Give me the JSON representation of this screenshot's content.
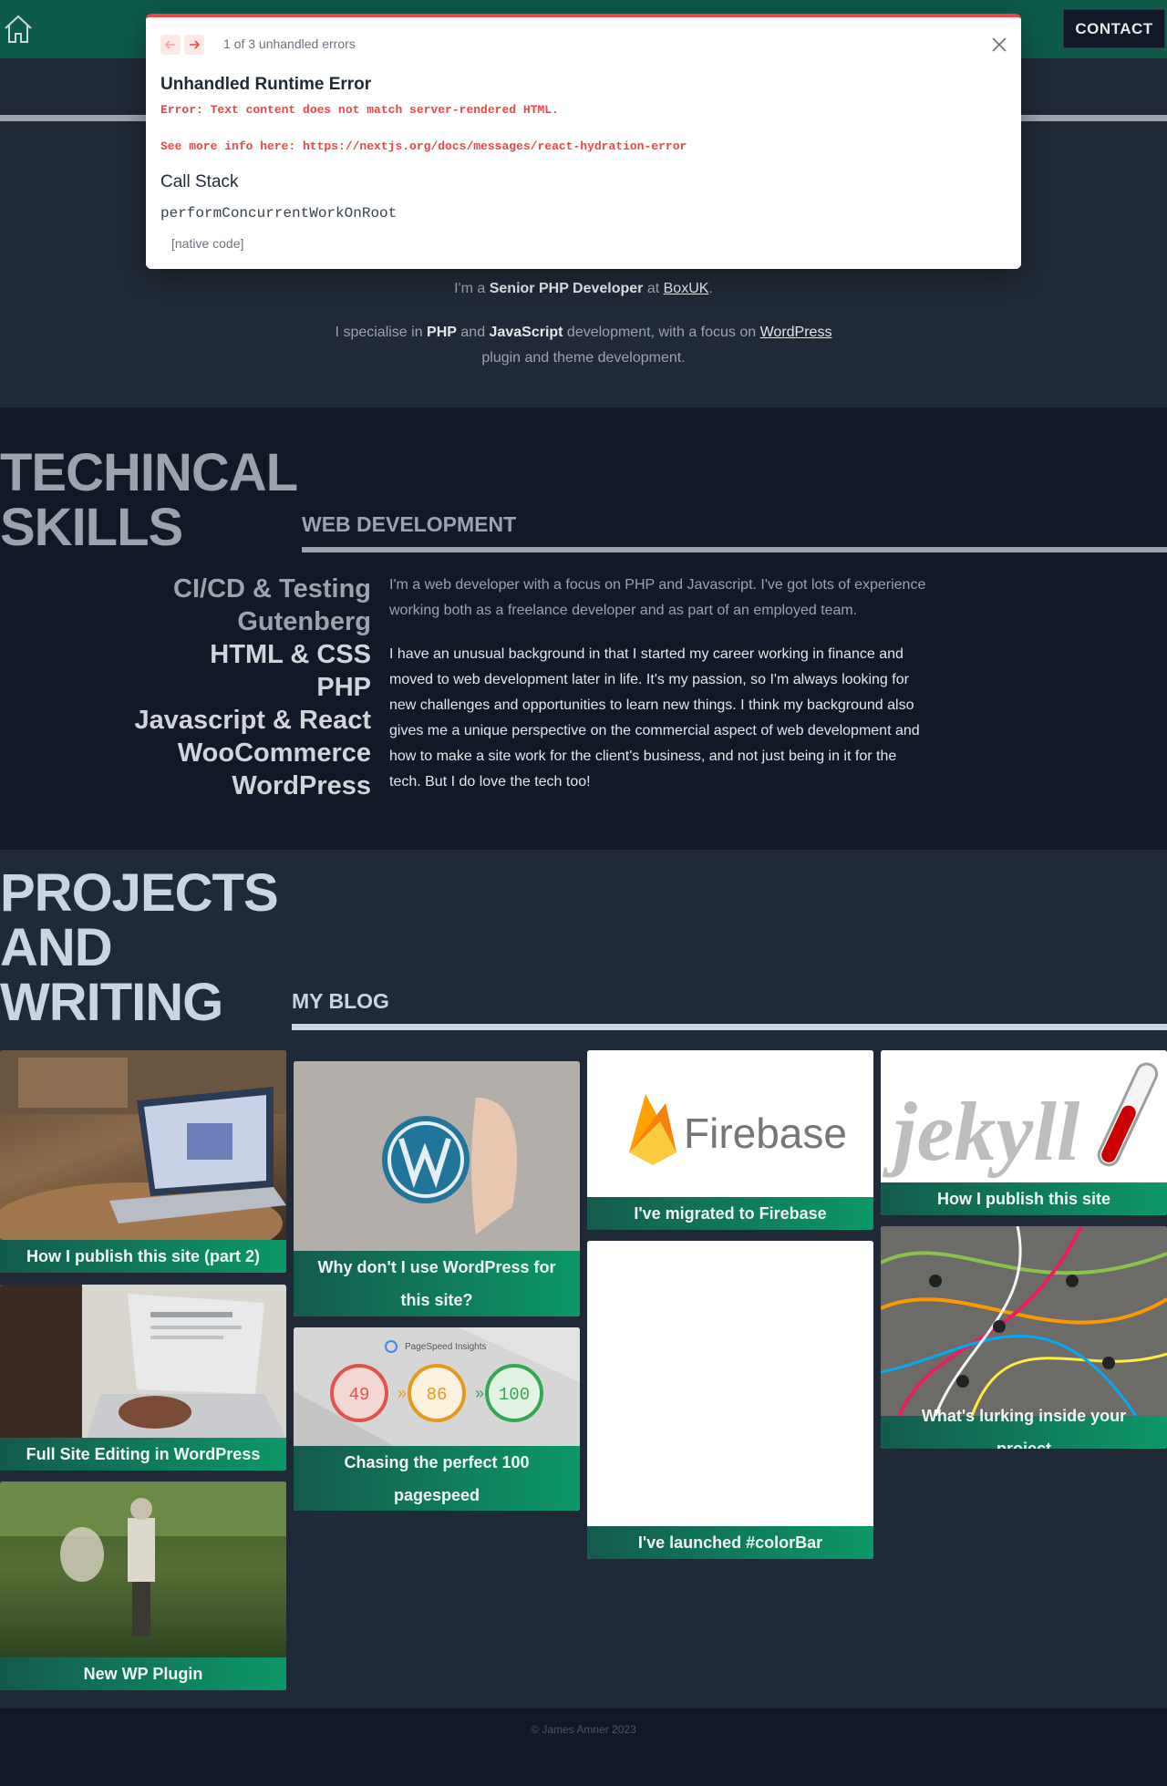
{
  "header": {
    "contact_label": "CONTACT"
  },
  "intro": {
    "line1_a": "I'm a ",
    "line1_role": "Senior PHP Developer",
    "line1_b": " at ",
    "line1_company": "BoxUK",
    "line1_c": ".",
    "line2_a": "I specialise in ",
    "line2_php": "PHP",
    "line2_b": " and ",
    "line2_js": "JavaScript",
    "line2_c": " development, with a focus on ",
    "line2_wp": "WordPress",
    "line3": "plugin and theme development."
  },
  "skills": {
    "title_line1": "TECHINCAL",
    "title_line2": "SKILLS",
    "heading": "WEB DEVELOPMENT",
    "items": [
      "CI/CD & Testing",
      "Gutenberg",
      "HTML & CSS",
      "PHP",
      "Javascript & React",
      "WooCommerce",
      "WordPress"
    ],
    "para1": "I'm a web developer with a focus on PHP and Javascript. I've got lots of experience working both as a freelance developer and as part of an employed team.",
    "para2": "I have an unusual background in that I started my career working in finance and moved to web development later in life. It's my passion, so I'm always looking for new challenges and opportunities to learn new things. I think my background also gives me a unique perspective on the commercial aspect of web development and how to make a site work for the client's business, and not just being in it for the tech. But I do love the tech too!"
  },
  "projects": {
    "title_line1": "PROJECTS",
    "title_line2": "AND",
    "title_line3": "WRITING",
    "heading": "MY BLOG",
    "cards": [
      "How I publish this site (part 2)",
      "Full Site Editing in WordPress",
      "New WP Plugin",
      "Why don't I use WordPress for this site?",
      "Chasing the perfect 100 pagespeed",
      "I've migrated to Firebase",
      "I've launched #colorBar",
      "How I publish this site",
      "What's lurking inside your project"
    ],
    "firebase_logo_text": "Firebase",
    "jekyll_logo_text": "jekyll",
    "pagespeed_header": "PageSpeed Insights",
    "pagespeed_scores": [
      "49",
      "86",
      "100"
    ]
  },
  "footer": {
    "copyright": "© James Amner 2023"
  },
  "error_overlay": {
    "count": "1 of 3 unhandled errors",
    "title": "Unhandled Runtime Error",
    "message": "Error: Text content does not match server-rendered HTML.",
    "more_info": "See more info here: https://nextjs.org/docs/messages/react-hydration-error",
    "stack_title": "Call Stack",
    "stack_fn": "performConcurrentWorkOnRoot",
    "native": "[native code]"
  },
  "colors": {
    "header_green": "#0e5b4a",
    "page_bg": "#1f2937",
    "section_dark": "#111827",
    "label_gradient_start": "#145a4d",
    "label_gradient_end": "#0c9868",
    "error_red": "#ef4444"
  }
}
